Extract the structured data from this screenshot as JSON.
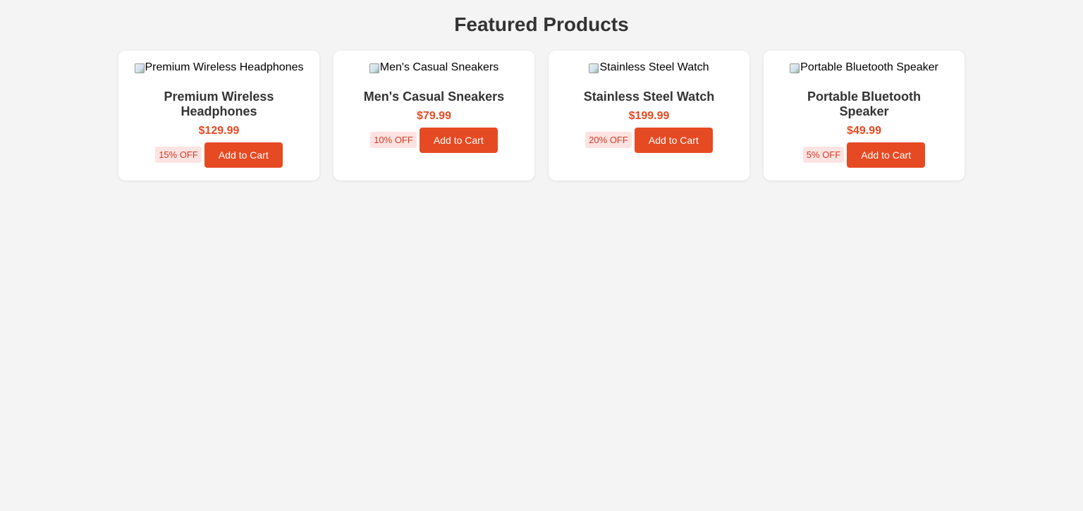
{
  "page": {
    "title": "Featured Products"
  },
  "colors": {
    "background": "#f4f4f4",
    "accent": "#e64a22",
    "badge_background": "#fde3e1",
    "badge_text": "#d23a25",
    "heading_text": "#333333"
  },
  "products": [
    {
      "image_alt": "Premium Wireless Headphones",
      "name": "Premium Wireless Headphones",
      "price": "$129.99",
      "discount": "15% OFF",
      "button_label": "Add to Cart"
    },
    {
      "image_alt": "Men's Casual Sneakers",
      "name": "Men's Casual Sneakers",
      "price": "$79.99",
      "discount": "10% OFF",
      "button_label": "Add to Cart"
    },
    {
      "image_alt": "Stainless Steel Watch",
      "name": "Stainless Steel Watch",
      "price": "$199.99",
      "discount": "20% OFF",
      "button_label": "Add to Cart"
    },
    {
      "image_alt": "Portable Bluetooth Speaker",
      "name": "Portable Bluetooth Speaker",
      "price": "$49.99",
      "discount": "5% OFF",
      "button_label": "Add to Cart"
    }
  ]
}
